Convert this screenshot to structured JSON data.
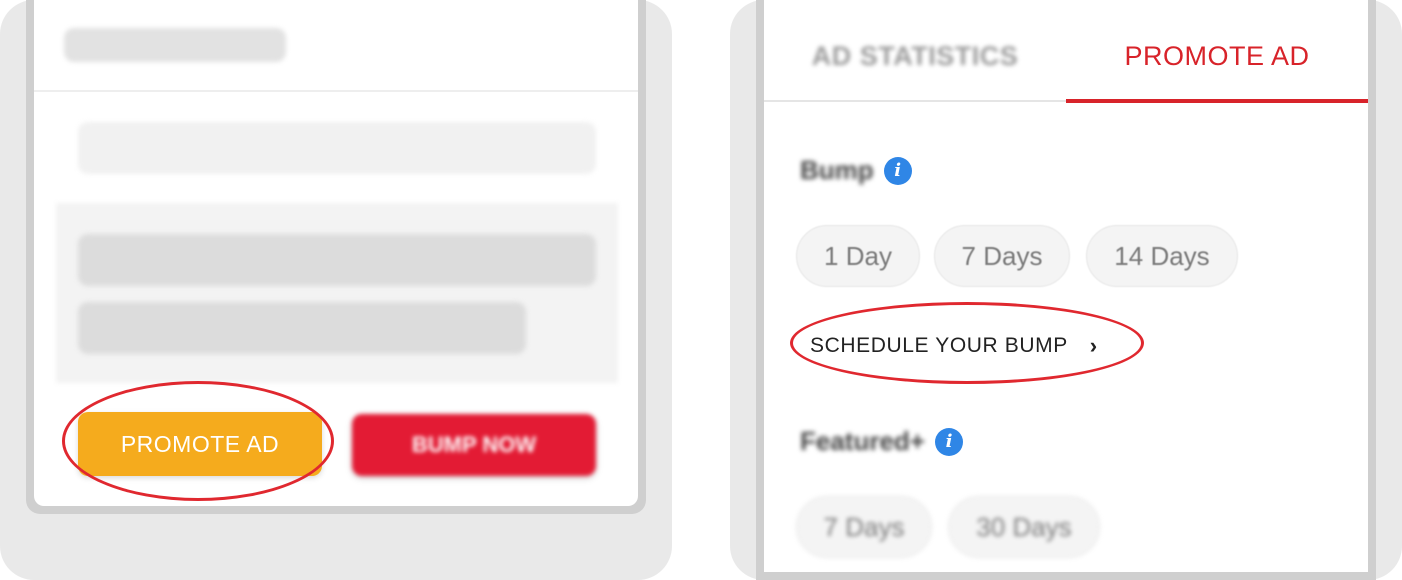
{
  "left_screen": {
    "promote_button_label": "PROMOTE AD",
    "bump_button_label": "BUMP NOW"
  },
  "right_screen": {
    "tabs": [
      {
        "label": "AD STATISTICS",
        "active": false
      },
      {
        "label": "PROMOTE AD",
        "active": true
      }
    ],
    "bump_section": {
      "title": "Bump",
      "options": [
        "1 Day",
        "7 Days",
        "14 Days"
      ],
      "schedule_link_label": "SCHEDULE YOUR BUMP"
    },
    "featured_section": {
      "title": "Featured+",
      "options": [
        "7 Days",
        "30 Days"
      ]
    }
  },
  "colors": {
    "promote_orange": "#f5ab1d",
    "bump_red": "#e31b34",
    "accent_red": "#d8232a",
    "info_blue": "#2f86e6",
    "highlight_ring": "#e0282f"
  },
  "icons": [
    "info-icon",
    "chevron-right-icon"
  ]
}
